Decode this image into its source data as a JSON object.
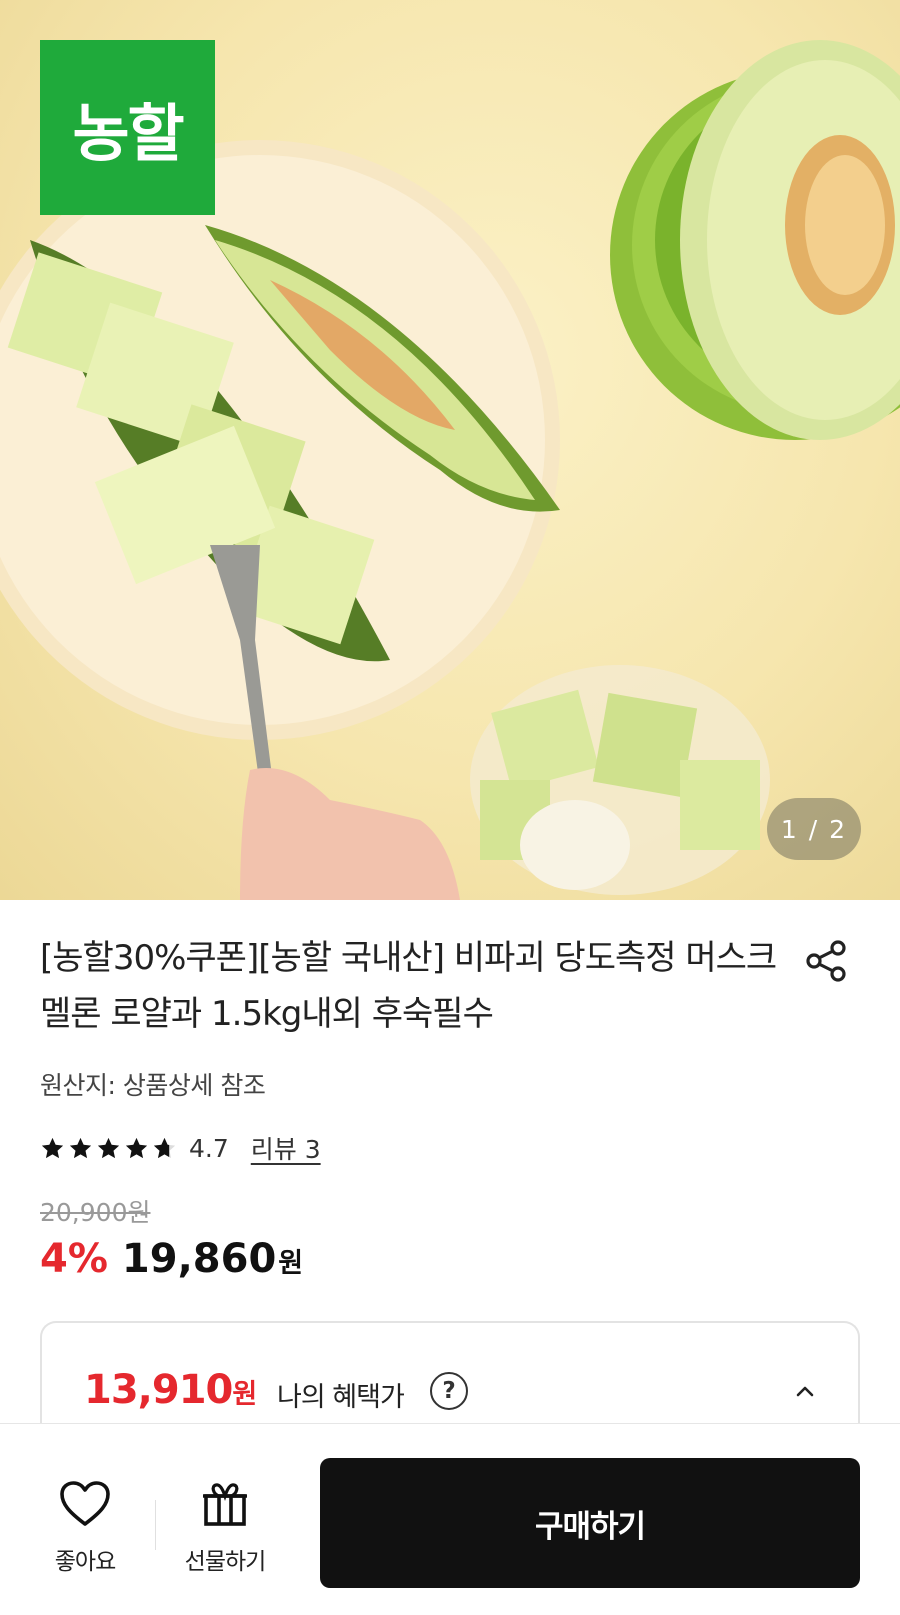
{
  "hero": {
    "image_alt": "melon product photo",
    "brand_badge": "농할",
    "page_indicator": "1 / 2"
  },
  "product": {
    "title": "[농할30%쿠폰][농할 국내산] 비파괴 당도측정 머스크멜론 로얄과 1.5kg내외 후숙필수",
    "origin": "원산지: 상품상세 참조",
    "rating": {
      "value": "4.7",
      "stars": 4.7,
      "review_link": "리뷰 3"
    },
    "original_price": "20,900원",
    "discount": "4%",
    "sale_price": "19,860",
    "currency": "원"
  },
  "benefit": {
    "price": "13,910",
    "currency": "원",
    "label": "나의 혜택가",
    "help_icon": "question-circle-icon",
    "toggle_icon": "chevron-up-icon"
  },
  "bottom_bar": {
    "like_label": "좋아요",
    "gift_label": "선물하기",
    "buy_label": "구매하기"
  },
  "colors": {
    "brand_green": "#1faa3b",
    "discount_red": "#e5282e",
    "buy_button": "#111111"
  }
}
